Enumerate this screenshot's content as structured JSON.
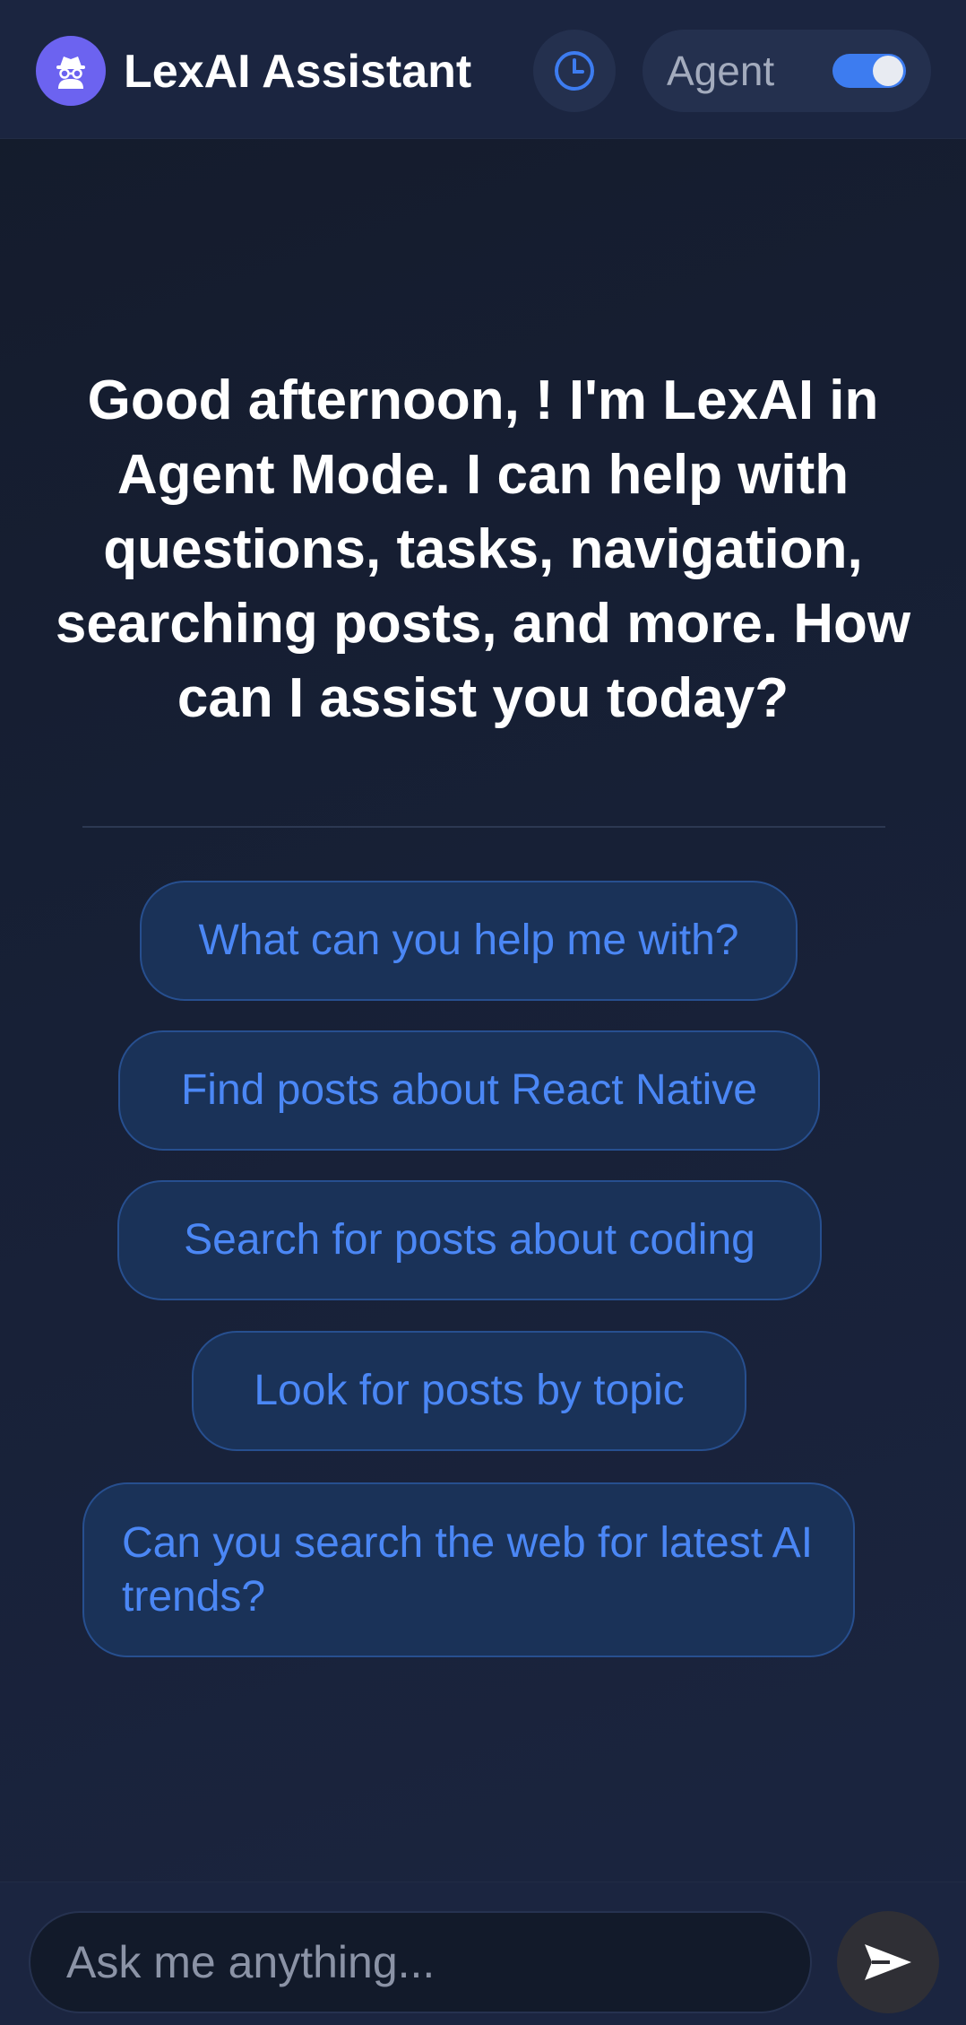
{
  "header": {
    "title": "LexAI Assistant",
    "avatar_icon": "incognito-agent-icon",
    "history_icon": "clock-icon",
    "mode_label": "Agent",
    "mode_enabled": true
  },
  "greeting": {
    "text": "Good afternoon, ! I'm LexAI in Agent Mode. I can help with questions, tasks, navigation, searching posts, and more. How can I assist you today?"
  },
  "suggestions": [
    "What can you help me with?",
    "Find posts about React Native",
    "Search for posts about coding",
    "Look for posts by topic",
    "Can you search the web for latest AI trends?"
  ],
  "input": {
    "placeholder": "Ask me anything...",
    "value": "",
    "send_icon": "send-arrow-icon"
  },
  "colors": {
    "accent": "#3d7cf0",
    "suggestion_text": "#4b87f5",
    "avatar_bg": "#6c63f0",
    "background": "#172036"
  }
}
